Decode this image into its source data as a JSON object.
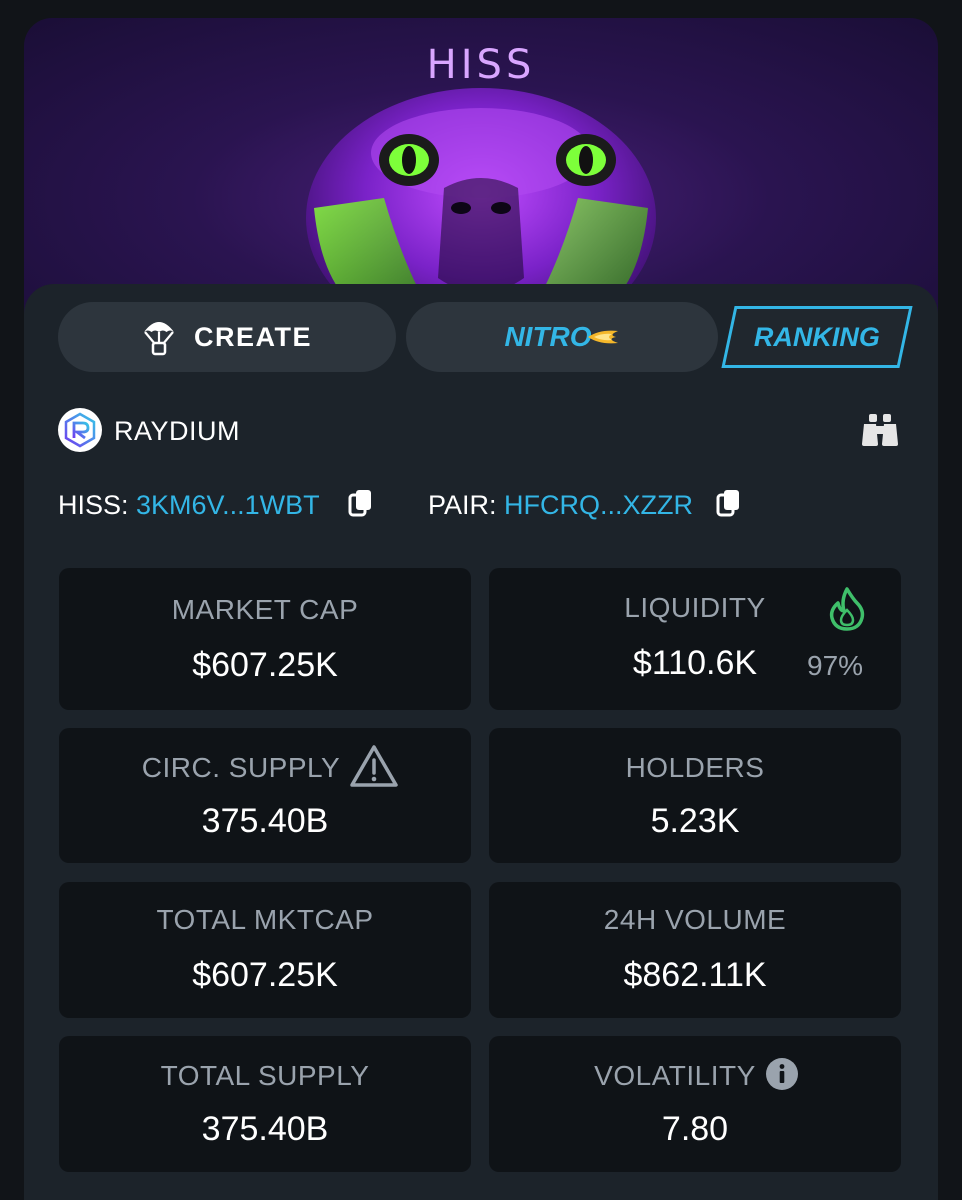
{
  "banner": {
    "title": "HISS"
  },
  "tabs": {
    "create": "CREATE",
    "nitro": "NITRO",
    "ranking": "RANKING"
  },
  "dex": {
    "name": "RAYDIUM"
  },
  "addresses": {
    "token_label": "HISS:",
    "token_value": "3KM6V...1WBT",
    "pair_label": "PAIR:",
    "pair_value": "HFCRQ...XZZR"
  },
  "stats": {
    "market_cap": {
      "label": "MARKET CAP",
      "value": "$607.25K"
    },
    "liquidity": {
      "label": "LIQUIDITY",
      "value": "$110.6K",
      "percent": "97%"
    },
    "circ_supply": {
      "label": "CIRC. SUPPLY",
      "value": "375.40B"
    },
    "holders": {
      "label": "HOLDERS",
      "value": "5.23K"
    },
    "total_mktcap": {
      "label": "TOTAL MKTCAP",
      "value": "$607.25K"
    },
    "volume_24h": {
      "label": "24H VOLUME",
      "value": "$862.11K"
    },
    "total_supply": {
      "label": "TOTAL SUPPLY",
      "value": "375.40B"
    },
    "volatility": {
      "label": "VOLATILITY",
      "value": "7.80"
    }
  },
  "colors": {
    "accent": "#33b6e6",
    "flame": "#3fbf6a",
    "card_bg": "#1c232a",
    "tile_bg": "#0f1317"
  },
  "icons": {
    "create": "parachute-icon",
    "dex": "raydium-logo",
    "explore": "binoculars-icon",
    "copy": "copy-icon",
    "liquidity_burn": "flame-icon",
    "warning": "warning-icon",
    "info": "info-icon"
  }
}
